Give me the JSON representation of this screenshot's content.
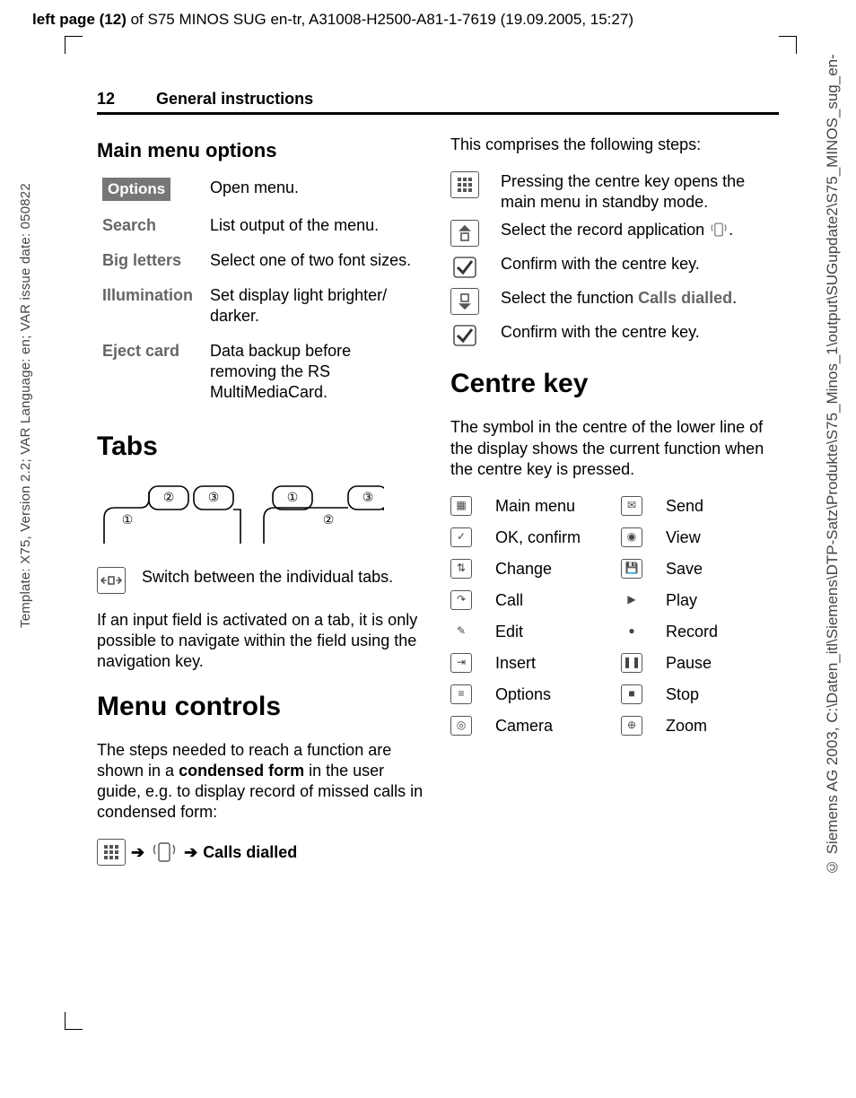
{
  "header": {
    "prefix_bold": "left page (12)",
    "rest": " of S75 MINOS SUG en-tr, A31008-H2500-A81-1-7619 (19.09.2005, 15:27)"
  },
  "side_left": "Template: X75, Version 2.2; VAR Language: en; VAR issue date: 050822",
  "side_right": "© Siemens AG 2003, C:\\Daten_itl\\Siemens\\DTP-Satz\\Produkte\\S75_Minos_1\\output\\SUGupdate2\\S75_MINOS_sug_en-",
  "running_head": {
    "page_num": "12",
    "title": "General instructions"
  },
  "left_col": {
    "main_menu_heading": "Main menu options",
    "options_label": "Options",
    "options_desc": "Open menu.",
    "rows": [
      {
        "k": "Search",
        "v": "List output of the menu."
      },
      {
        "k": "Big letters",
        "v": "Select one of two font sizes."
      },
      {
        "k": "Illumination",
        "v": "Set display light brighter/ darker."
      },
      {
        "k": "Eject card",
        "v": "Data backup before removing the RS MultiMediaCard."
      }
    ],
    "tabs_heading": "Tabs",
    "tabs_switch_text": "Switch between the individual tabs.",
    "tabs_note": "If an input field is activated on a tab, it is only possible to navigate within the field using the navigation key.",
    "menu_controls_heading": "Menu controls",
    "menu_controls_intro_a": "The steps needed to reach a function are shown in a ",
    "menu_controls_intro_bold": "condensed form",
    "menu_controls_intro_b": " in the user guide, e.g. to display record of missed calls in condensed form:",
    "path_label": "Calls dialled"
  },
  "right_col": {
    "intro": "This comprises the following steps:",
    "steps": [
      {
        "icon": "grid",
        "text": "Pressing the centre key opens the main menu in standby mode."
      },
      {
        "icon": "up-box",
        "text_a": "Select the record application ",
        "text_b": "."
      },
      {
        "icon": "check",
        "text": "Confirm with the centre key."
      },
      {
        "icon": "down-box",
        "text_a": "Select the function ",
        "bold": "Calls dialled",
        "text_b": "."
      },
      {
        "icon": "check",
        "text": "Confirm with the centre key."
      }
    ],
    "centre_key_heading": "Centre key",
    "centre_key_intro": "The symbol in the centre of the lower line of the display shows the current function when the centre key is pressed.",
    "ck_items": [
      {
        "icon": "grid",
        "label": "Main menu"
      },
      {
        "icon": "mail",
        "label": "Send"
      },
      {
        "icon": "check",
        "label": "OK, confirm"
      },
      {
        "icon": "circle-dot",
        "label": "View"
      },
      {
        "icon": "sync",
        "label": "Change"
      },
      {
        "icon": "disk",
        "label": "Save"
      },
      {
        "icon": "call",
        "label": "Call"
      },
      {
        "icon": "play",
        "label": "Play"
      },
      {
        "icon": "pencil",
        "label": "Edit"
      },
      {
        "icon": "record",
        "label": "Record"
      },
      {
        "icon": "insert",
        "label": "Insert"
      },
      {
        "icon": "pause",
        "label": "Pause"
      },
      {
        "icon": "list",
        "label": "Options"
      },
      {
        "icon": "stop",
        "label": "Stop"
      },
      {
        "icon": "camera",
        "label": "Camera"
      },
      {
        "icon": "zoom",
        "label": "Zoom"
      }
    ]
  }
}
